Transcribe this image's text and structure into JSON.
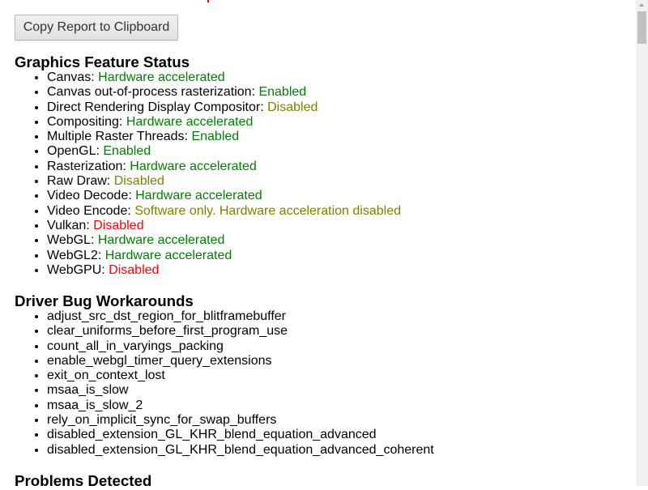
{
  "toolbar": {
    "copy_label": "Copy Report to Clipboard"
  },
  "colors": {
    "enabled": "#008000",
    "warning": "#808000",
    "disabled": "#ff0000"
  },
  "feature_status": {
    "title": "Graphics Feature Status",
    "items": [
      {
        "name": "Canvas: ",
        "value": "Hardware accelerated",
        "status": "green"
      },
      {
        "name": "Canvas out-of-process rasterization: ",
        "value": "Enabled",
        "status": "green"
      },
      {
        "name": "Direct Rendering Display Compositor: ",
        "value": "Disabled",
        "status": "olive"
      },
      {
        "name": "Compositing: ",
        "value": "Hardware accelerated",
        "status": "green"
      },
      {
        "name": "Multiple Raster Threads: ",
        "value": "Enabled",
        "status": "green"
      },
      {
        "name": "OpenGL: ",
        "value": "Enabled",
        "status": "green"
      },
      {
        "name": "Rasterization: ",
        "value": "Hardware accelerated",
        "status": "green"
      },
      {
        "name": "Raw Draw: ",
        "value": "Disabled",
        "status": "olive"
      },
      {
        "name": "Video Decode: ",
        "value": "Hardware accelerated",
        "status": "green"
      },
      {
        "name": "Video Encode: ",
        "value": "Software only. Hardware acceleration disabled",
        "status": "olive"
      },
      {
        "name": "Vulkan: ",
        "value": "Disabled",
        "status": "red"
      },
      {
        "name": "WebGL: ",
        "value": "Hardware accelerated",
        "status": "green"
      },
      {
        "name": "WebGL2: ",
        "value": "Hardware accelerated",
        "status": "green"
      },
      {
        "name": "WebGPU: ",
        "value": "Disabled",
        "status": "red"
      }
    ]
  },
  "workarounds": {
    "title": "Driver Bug Workarounds",
    "items": [
      "adjust_src_dst_region_for_blitframebuffer",
      "clear_uniforms_before_first_program_use",
      "count_all_in_varyings_packing",
      "enable_webgl_timer_query_extensions",
      "exit_on_context_lost",
      "msaa_is_slow",
      "msaa_is_slow_2",
      "rely_on_implicit_sync_for_swap_buffers",
      "disabled_extension_GL_KHR_blend_equation_advanced",
      "disabled_extension_GL_KHR_blend_equation_advanced_coherent"
    ]
  },
  "problems": {
    "title": "Problems Detected"
  }
}
